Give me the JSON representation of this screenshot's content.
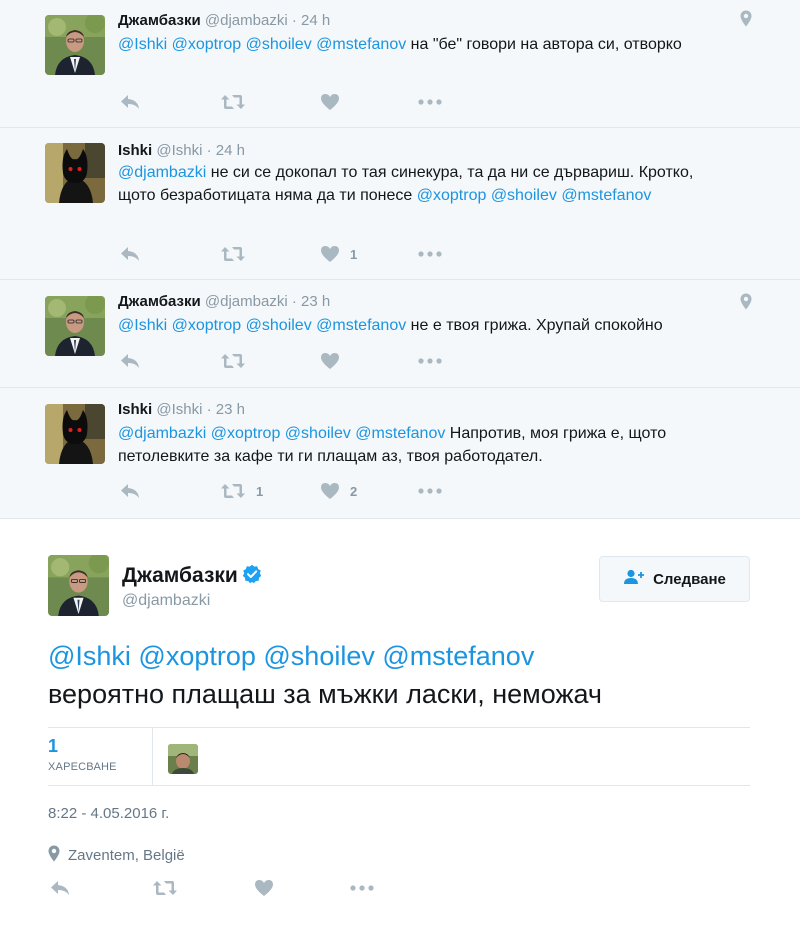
{
  "thread": [
    {
      "name": "Джамбазки",
      "handle": "@djambazki",
      "time": "24 h",
      "avatar": "man-avatar",
      "has_geo": true,
      "parts": [
        {
          "t": "@Ishki",
          "m": true
        },
        {
          "t": " ",
          "m": false
        },
        {
          "t": "@xoptrop",
          "m": true
        },
        {
          "t": " ",
          "m": false
        },
        {
          "t": "@shoilev",
          "m": true
        },
        {
          "t": " ",
          "m": false
        },
        {
          "t": "@mstefanov",
          "m": true
        },
        {
          "t": " на \"бе\" говори на автора си, отворко",
          "m": false
        }
      ],
      "retweets": "",
      "likes": ""
    },
    {
      "name": "Ishki",
      "handle": "@Ishki",
      "time": "24 h",
      "avatar": "dark-figure-avatar",
      "has_geo": false,
      "parts": [
        {
          "t": "@djambazki",
          "m": true
        },
        {
          "t": " не си се докопал то тая синекура, та да ни се дървариш. Кротко, щото безработицата няма да ти понесе ",
          "m": false
        },
        {
          "t": "@xoptrop",
          "m": true
        },
        {
          "t": " ",
          "m": false
        },
        {
          "t": "@shoilev",
          "m": true
        },
        {
          "t": " ",
          "m": false
        },
        {
          "t": "@mstefanov",
          "m": true
        }
      ],
      "retweets": "",
      "likes": "1"
    },
    {
      "name": "Джамбазки",
      "handle": "@djambazki",
      "time": "23 h",
      "avatar": "man-avatar",
      "has_geo": true,
      "parts": [
        {
          "t": "@Ishki",
          "m": true
        },
        {
          "t": " ",
          "m": false
        },
        {
          "t": "@xoptrop",
          "m": true
        },
        {
          "t": " ",
          "m": false
        },
        {
          "t": "@shoilev",
          "m": true
        },
        {
          "t": " ",
          "m": false
        },
        {
          "t": "@mstefanov",
          "m": true
        },
        {
          "t": " не е твоя грижа. Хрупай спокойно",
          "m": false
        }
      ],
      "retweets": "",
      "likes": ""
    },
    {
      "name": "Ishki",
      "handle": "@Ishki",
      "time": "23 h",
      "avatar": "dark-figure-avatar",
      "has_geo": false,
      "parts": [
        {
          "t": "@djambazki",
          "m": true
        },
        {
          "t": " ",
          "m": false
        },
        {
          "t": "@xoptrop",
          "m": true
        },
        {
          "t": " ",
          "m": false
        },
        {
          "t": "@shoilev",
          "m": true
        },
        {
          "t": " ",
          "m": false
        },
        {
          "t": "@mstefanov",
          "m": true
        },
        {
          "t": " Напротив, моя грижа е, щото петолевките за кафе ти ги плащам аз, твоя работодател.",
          "m": false
        }
      ],
      "retweets": "1",
      "likes": "2"
    }
  ],
  "main": {
    "name": "Джамбазки",
    "handle": "@djambazki",
    "verified": true,
    "follow_label": "Следване",
    "mention_line": "@Ishki @xoptrop @shoilev @mstefanov",
    "text_line": "вероятно плащаш за мъжки ласки, неможач",
    "like_count": "1",
    "like_label": "ХАРЕСВАНЕ",
    "datetime": "8:22 - 4.05.2016 г.",
    "location": "Zaventem, België"
  },
  "colors": {
    "link": "#1b95e0",
    "muted": "#8899a6",
    "icon": "#aab8c2",
    "thread_bg": "#f5f8fa",
    "border": "#e1e8ed"
  },
  "icons": [
    "reply-icon",
    "retweet-icon",
    "heart-icon",
    "more-icon",
    "geo-pin-icon",
    "verified-icon",
    "follow-user-icon"
  ]
}
